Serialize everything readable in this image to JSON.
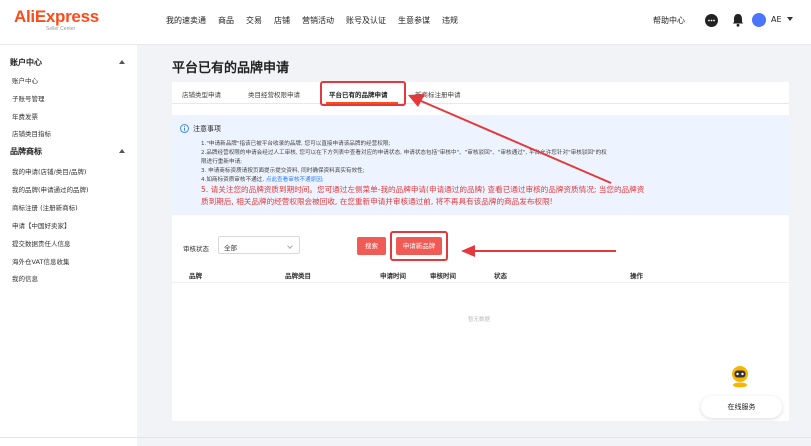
{
  "header": {
    "logo_main": "AliExpress",
    "logo_sub": "Seller Center",
    "nav": [
      "我的速卖通",
      "商品",
      "交易",
      "店铺",
      "营销活动",
      "账号及认证",
      "生意参谋",
      "违规"
    ],
    "help": "帮助中心",
    "lang": "AE"
  },
  "sidebar": {
    "account": {
      "title": "账户中心",
      "items": [
        "账户中心",
        "子账号管理",
        "年费发票",
        "店铺类目指标"
      ]
    },
    "brand": {
      "title": "品牌商标",
      "items": [
        "我的申请(店铺/类目/品牌)",
        "我的品牌(申请通过的品牌)",
        "商标注册 (注册新商标)",
        "申请【中国好卖家】",
        "提交数据责任人信息",
        "海外仓VAT信息收集",
        "我的信息"
      ]
    }
  },
  "page": {
    "title": "平台已有的品牌申请",
    "tabs": [
      "店铺类型申请",
      "类目经营权限申请",
      "平台已有的品牌申请",
      "新商标注册申请"
    ],
    "active_tab": 2
  },
  "notice": {
    "title": "注意事项",
    "line1": "1.\"申请新品牌\"指该已被平台收录的品牌, 您可以直接申请该品牌的经营权限;",
    "line2": "2.品牌经营权限的申请会经过人工审核, 您可以在下方列表中查看对应的申请状态, 申请状态包括\"审核中\"、\"审核驳回\"、\"审核通过\", 平台允许您针对\"审核驳回\"的权",
    "line2b": "限进行重新申请;",
    "line3": "3. 申请商标资质请按页面提示提交资料, 同时确保资料真实有效性;",
    "line4_pre": "4.如商标资质审核不通过, ",
    "line4_link": "点此查看审核不通原因;",
    "red1": "5. 请关注您的品牌资质到期时间。您可通过左侧菜单-我的品牌申请(申请通过的品牌) 查看已通过审核的品牌资质情况; 当您的品牌资",
    "red2": "质到期后, 相关品牌的经营权限会被回收, 在您重新申请并审核通过前, 将不再具有该品牌的商品发布权限!"
  },
  "filter": {
    "label": "审核状态",
    "value": "全部",
    "search_btn": "搜索",
    "apply_btn": "申请新品牌"
  },
  "table": {
    "headers": [
      "品牌",
      "品牌类目",
      "申请时间",
      "审核时间",
      "状态",
      "操作"
    ],
    "empty": "暂无数据"
  },
  "service": {
    "label": "在线服务"
  },
  "colors": {
    "brand": "#ff4a1a",
    "primary_btn": "#f05b55",
    "highlight": "#e4393c",
    "notice_bg": "#eef4ff"
  }
}
